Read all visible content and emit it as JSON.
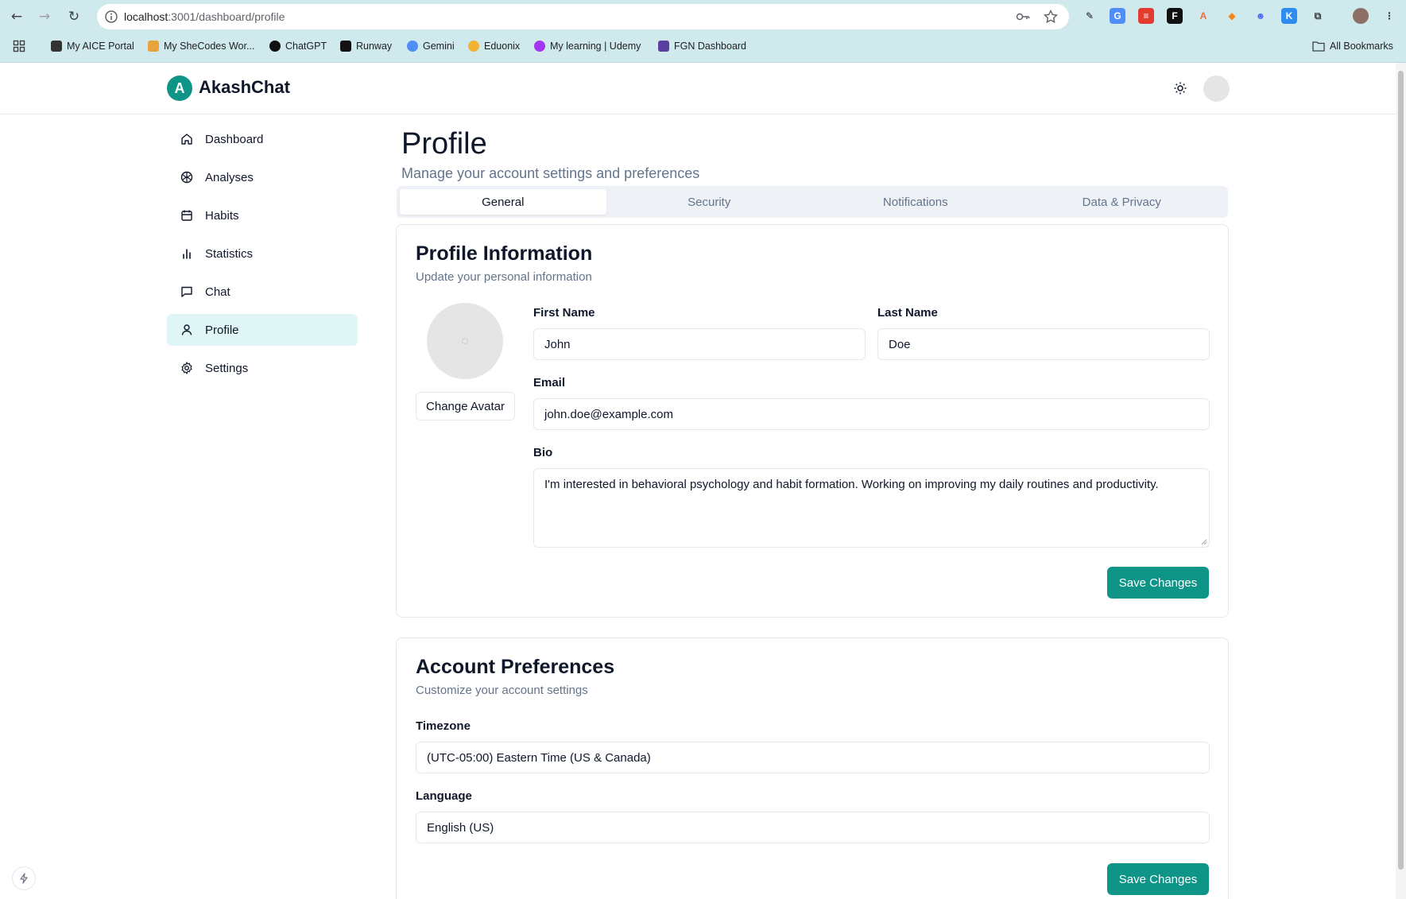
{
  "browser": {
    "url_host": "localhost",
    "url_path": ":3001/dashboard/profile",
    "bookmarks": [
      {
        "label": "My AICE Portal",
        "color": "#333333"
      },
      {
        "label": "My SheCodes Wor...",
        "color": "#e8a33d"
      },
      {
        "label": "ChatGPT",
        "color": "#111111"
      },
      {
        "label": "Runway",
        "color": "#111111"
      },
      {
        "label": "Gemini",
        "color": "#4f8ef7"
      },
      {
        "label": "Eduonix",
        "color": "#f2b233"
      },
      {
        "label": "My learning | Udemy",
        "color": "#a435f0"
      },
      {
        "label": "FGN Dashboard",
        "color": "#5b3fa0"
      }
    ],
    "all_bookmarks": "All Bookmarks"
  },
  "app": {
    "logo_letter": "A",
    "name": "AkashChat",
    "accent": "#0f9488"
  },
  "sidebar": {
    "items": [
      {
        "label": "Dashboard",
        "icon": "home-icon"
      },
      {
        "label": "Analyses",
        "icon": "brain-icon"
      },
      {
        "label": "Habits",
        "icon": "calendar-icon"
      },
      {
        "label": "Statistics",
        "icon": "bar-chart-icon"
      },
      {
        "label": "Chat",
        "icon": "message-icon"
      },
      {
        "label": "Profile",
        "icon": "user-icon",
        "active": true
      },
      {
        "label": "Settings",
        "icon": "gear-icon"
      }
    ]
  },
  "page": {
    "title": "Profile",
    "subtitle": "Manage your account settings and preferences"
  },
  "tabs": [
    {
      "label": "General",
      "active": true
    },
    {
      "label": "Security"
    },
    {
      "label": "Notifications"
    },
    {
      "label": "Data & Privacy"
    }
  ],
  "profile_card": {
    "title": "Profile Information",
    "subtitle": "Update your personal information",
    "change_avatar": "Change Avatar",
    "first_name_label": "First Name",
    "first_name": "John",
    "last_name_label": "Last Name",
    "last_name": "Doe",
    "email_label": "Email",
    "email": "john.doe@example.com",
    "bio_label": "Bio",
    "bio": "I'm interested in behavioral psychology and habit formation. Working on improving my daily routines and productivity.",
    "save": "Save Changes"
  },
  "prefs_card": {
    "title": "Account Preferences",
    "subtitle": "Customize your account settings",
    "timezone_label": "Timezone",
    "timezone": "(UTC-05:00) Eastern Time (US & Canada)",
    "language_label": "Language",
    "language": "English (US)",
    "save": "Save Changes"
  }
}
